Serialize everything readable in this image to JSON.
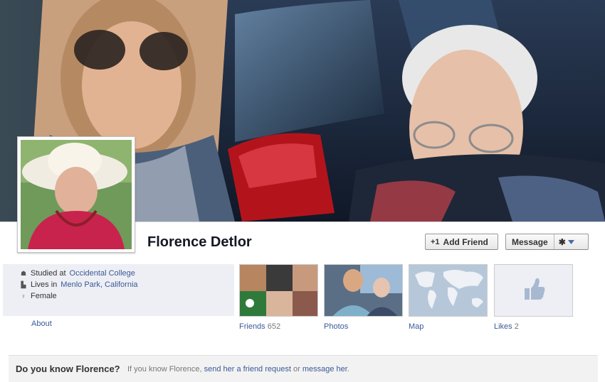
{
  "profile": {
    "name": "Florence Detlor"
  },
  "actions": {
    "add_friend_label": "Add Friend",
    "add_friend_icon": "+1",
    "message_label": "Message",
    "settings_icon": "gear-icon"
  },
  "info": {
    "studied_prefix": "Studied at",
    "studied_value": "Occidental College",
    "lives_prefix": "Lives in",
    "lives_value": "Menlo Park, California",
    "gender": "Female"
  },
  "about_label": "About",
  "tiles": {
    "friends": {
      "label": "Friends",
      "count": "652"
    },
    "photos": {
      "label": "Photos"
    },
    "map": {
      "label": "Map"
    },
    "likes": {
      "label": "Likes",
      "count": "2"
    }
  },
  "know": {
    "title": "Do you know Florence?",
    "text_prefix": "If you know Florence,",
    "link1": "send her a friend request",
    "text_mid": "or",
    "link2": "message her",
    "text_suffix": "."
  },
  "colors": {
    "link": "#3b5998",
    "info_bg": "#edeff4"
  }
}
